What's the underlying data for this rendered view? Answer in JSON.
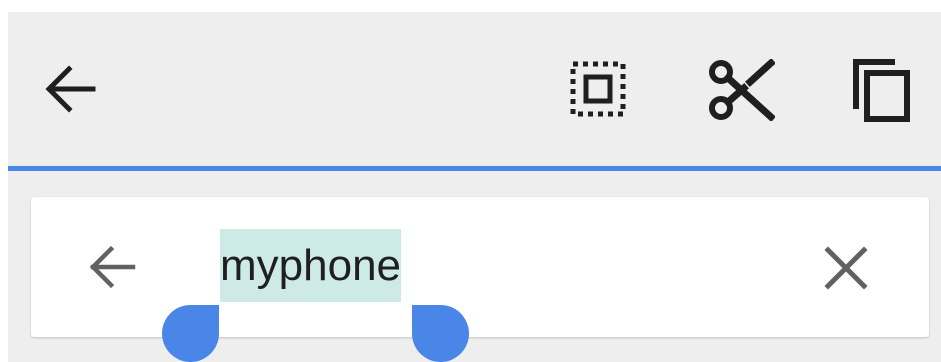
{
  "action_bar": {
    "icons": {
      "back": "arrow-left-icon",
      "select_all": "select-all-icon",
      "cut": "scissors-icon",
      "copy": "copy-icon"
    }
  },
  "search": {
    "value": "myphone",
    "icons": {
      "back": "arrow-left-icon",
      "clear": "close-icon"
    }
  },
  "colors": {
    "accent": "#4a86e8",
    "selection": "#cdeae7",
    "bar_background": "#eeeeee",
    "icon_dark": "#1f1f1f",
    "icon_grey": "#616161"
  }
}
